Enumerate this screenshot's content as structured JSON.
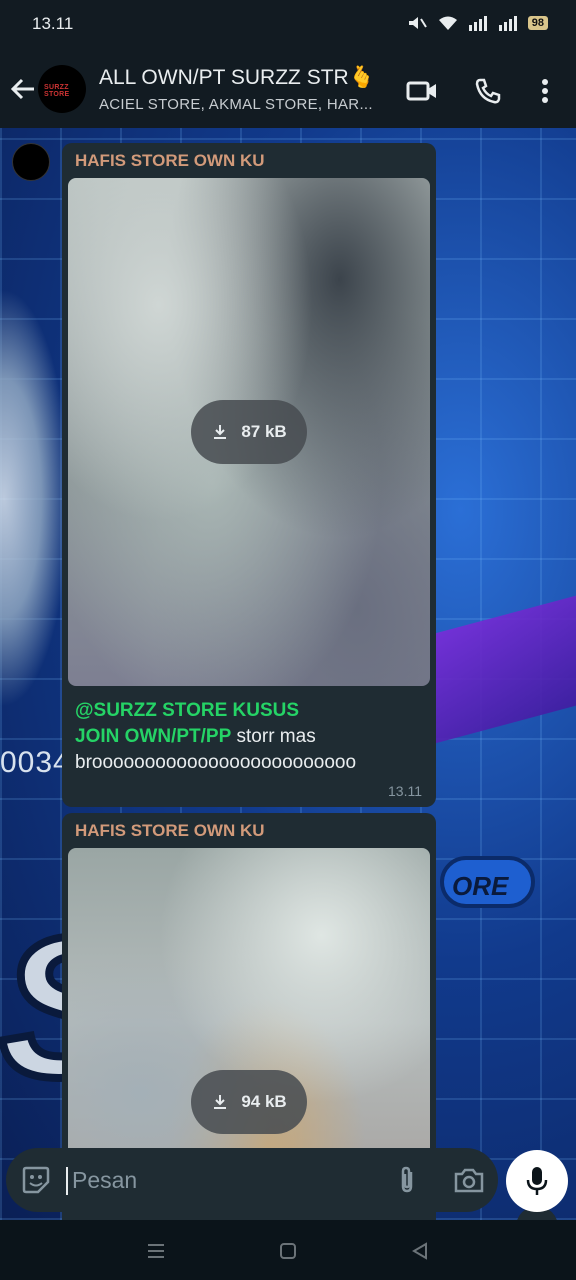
{
  "status_bar": {
    "time": "13.11",
    "battery": "98"
  },
  "header": {
    "title": "ALL OWN/PT SURZZ STR🫰",
    "subtitle": "ACIEL STORE, AKMAL STORE, HAR...",
    "avatar_text": "SURZZ STORE"
  },
  "wallpaper": {
    "number_text": "0034",
    "store_text": "ORE",
    "big_text": "SZZ"
  },
  "messages": [
    {
      "sender": "HAFIS STORE OWN KU",
      "download_size": "87 kB",
      "caption_mention_1": "@SURZZ STORE KUSUS",
      "caption_mention_2": "JOIN OWN/PT/PP",
      "caption_text": " storr mas brooooooooooooooooooooooooo",
      "time": "13.11"
    },
    {
      "sender": "HAFIS STORE OWN KU",
      "download_size": "94 kB"
    }
  ],
  "input": {
    "placeholder": "Pesan"
  },
  "colors": {
    "accent": "#25d366",
    "sender_name": "#d29a7a",
    "bubble": "#1f2c33"
  }
}
